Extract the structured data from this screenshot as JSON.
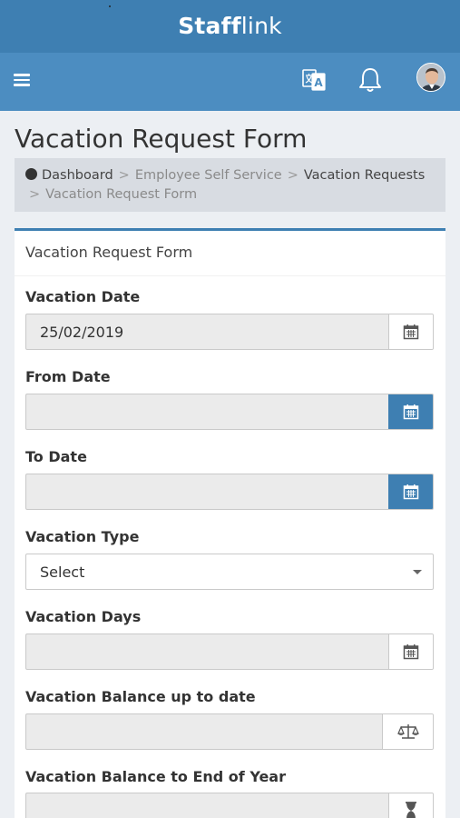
{
  "app": {
    "brand_bold": "Staff",
    "brand_light": "link"
  },
  "page": {
    "title": "Vacation Request Form"
  },
  "breadcrumb": {
    "items": [
      "Dashboard",
      "Employee Self Service",
      "Vacation Requests",
      "Vacation Request Form"
    ],
    "separator": ">"
  },
  "form": {
    "header": "Vacation Request Form",
    "fields": [
      {
        "label": "Vacation Date",
        "value": "25/02/2019",
        "icon": "calendar-icon"
      },
      {
        "label": "From Date",
        "value": "",
        "icon": "calendar-icon"
      },
      {
        "label": "To Date",
        "value": "",
        "icon": "calendar-icon"
      },
      {
        "label": "Vacation Type",
        "value": "Select",
        "icon": "chevron-down-icon"
      },
      {
        "label": "Vacation Days",
        "value": "",
        "icon": "calendar-icon"
      },
      {
        "label": "Vacation Balance up to date",
        "value": "",
        "icon": "scale-icon"
      },
      {
        "label": "Vacation Balance to End of Year",
        "value": "",
        "icon": "hourglass-icon"
      }
    ]
  },
  "colors": {
    "brand": "#3e7fb2",
    "nav": "#4c8dc1",
    "page_bg": "#eceff3"
  }
}
